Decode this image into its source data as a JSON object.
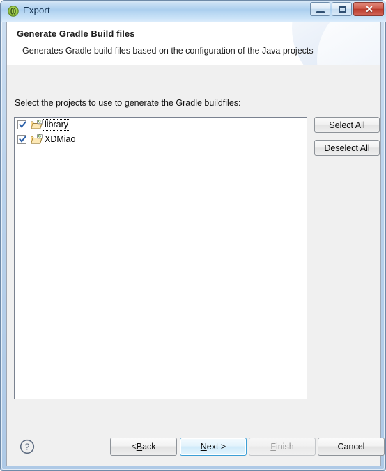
{
  "window": {
    "title": "Export",
    "icon": "export-wizard-icon",
    "controls": {
      "minimize": "minimize-icon",
      "maximize": "maximize-icon",
      "close": "✕"
    }
  },
  "header": {
    "title": "Generate Gradle Build files",
    "description": "Generates Gradle build files based on the configuration of the Java projects"
  },
  "body": {
    "instruction_before": "Select the projects to use to ",
    "instruction_mnemonic": "g",
    "instruction_after": "enerate the Gradle buildfiles:",
    "projects": [
      {
        "label": "library",
        "checked": true,
        "focused": true,
        "icon": "project-folder-icon"
      },
      {
        "label": "XDMiao",
        "checked": true,
        "focused": false,
        "icon": "project-folder-icon"
      }
    ],
    "side_buttons": {
      "select_all_before": "",
      "select_all_mnemonic": "S",
      "select_all_after": "elect All",
      "deselect_all_before": "",
      "deselect_all_mnemonic": "D",
      "deselect_all_after": "eselect All"
    }
  },
  "footer": {
    "help_icon": "help-icon",
    "back_before": "< ",
    "back_mnemonic": "B",
    "back_after": "ack",
    "next_before": "",
    "next_mnemonic": "N",
    "next_after": "ext >",
    "finish_before": "",
    "finish_mnemonic": "F",
    "finish_after": "inish",
    "cancel_label": "Cancel",
    "finish_enabled": false
  },
  "colors": {
    "titlebar_accent": "#a9cdee",
    "close_button": "#b93b2c",
    "default_button_focus": "#3c9fd6",
    "checkbox_check": "#2a5fa8",
    "folder_badge": "#6cb033",
    "window_border": "#6f8aa8"
  }
}
